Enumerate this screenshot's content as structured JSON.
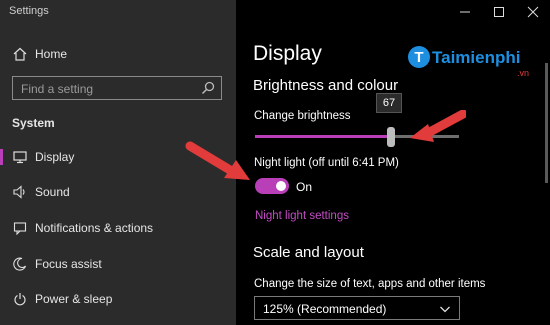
{
  "window": {
    "title": "Settings"
  },
  "sidebar": {
    "home_label": "Home",
    "search_placeholder": "Find a setting",
    "section_label": "System",
    "items": [
      {
        "label": "Display",
        "icon": "monitor-icon"
      },
      {
        "label": "Sound",
        "icon": "speaker-icon"
      },
      {
        "label": "Notifications & actions",
        "icon": "notifications-icon"
      },
      {
        "label": "Focus assist",
        "icon": "moon-icon"
      },
      {
        "label": "Power & sleep",
        "icon": "power-icon"
      }
    ]
  },
  "main": {
    "title": "Display",
    "section_brightness": "Brightness and colour",
    "brightness_label": "Change brightness",
    "brightness_value": "67",
    "brightness_level": 67,
    "night_light_label": "Night light (off until 6:41 PM)",
    "night_light_state": "On",
    "night_light_link": "Night light settings",
    "section_scale": "Scale and layout",
    "scale_label": "Change the size of text, apps and other items",
    "scale_value": "125% (Recommended)"
  },
  "watermark": {
    "name": "Taimienphi",
    "suffix": ".vn"
  },
  "colors": {
    "accent": "#b83fb8",
    "sidebar_bg": "#2b2b2b",
    "main_bg": "#000000",
    "arrow": "#e23b3b"
  }
}
